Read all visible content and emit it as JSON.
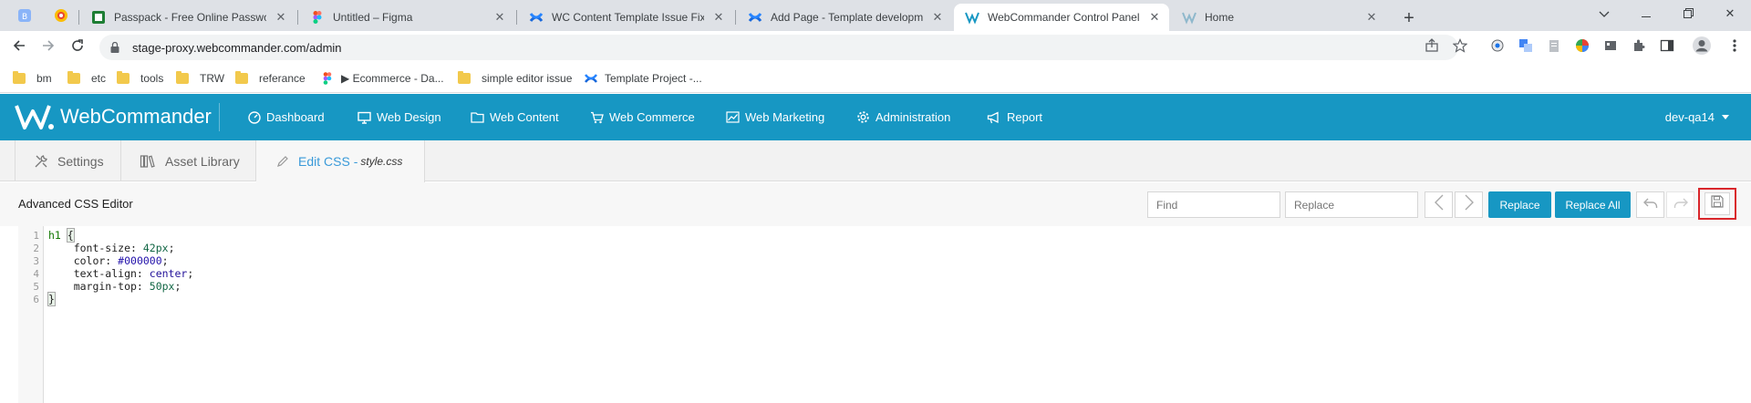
{
  "browser": {
    "tabs": [
      {
        "title": "Passpack - Free Online Password"
      },
      {
        "title": "Untitled – Figma"
      },
      {
        "title": "WC Content Template Issue Fixin"
      },
      {
        "title": "Add Page - Template developme"
      },
      {
        "title": "WebCommander Control Panel"
      },
      {
        "title": "Home"
      }
    ],
    "url": "stage-proxy.webcommander.com/admin",
    "bookmarks": [
      {
        "label": "bm"
      },
      {
        "label": "etc"
      },
      {
        "label": "tools"
      },
      {
        "label": "TRW"
      },
      {
        "label": "referance"
      },
      {
        "label": "▶ Ecommerce - Da..."
      },
      {
        "label": "simple editor issue"
      },
      {
        "label": "Template Project -..."
      }
    ]
  },
  "app": {
    "logo": "WebCommander",
    "nav": [
      {
        "label": "Dashboard",
        "icon": "dashboard-icon"
      },
      {
        "label": "Web Design",
        "icon": "monitor-icon"
      },
      {
        "label": "Web Content",
        "icon": "folder-icon"
      },
      {
        "label": "Web Commerce",
        "icon": "cart-icon"
      },
      {
        "label": "Web Marketing",
        "icon": "chart-icon"
      },
      {
        "label": "Administration",
        "icon": "gear-icon"
      },
      {
        "label": "Report",
        "icon": "megaphone-icon"
      }
    ],
    "user": "dev-qa14",
    "accent": "#1797c3"
  },
  "subtabs": {
    "settings": "Settings",
    "asset_library": "Asset Library",
    "edit_css": "Edit CSS -",
    "edit_css_file": "style.css"
  },
  "editor": {
    "title": "Advanced CSS Editor",
    "find_placeholder": "Find",
    "replace_placeholder": "Replace",
    "replace_label": "Replace",
    "replace_all_label": "Replace All",
    "line_numbers": [
      "1",
      "2",
      "3",
      "4",
      "5",
      "6"
    ],
    "code": {
      "l1_sel": "h1",
      "l1_brace": "{",
      "l2_prop": "    font-size: ",
      "l2_val": "42px",
      "l3_prop": "    color: ",
      "l3_val": "#000000",
      "l4_prop": "    text-align: ",
      "l4_val": "center",
      "l5_prop": "    margin-top: ",
      "l5_val": "50px",
      "semi": ";",
      "l6_brace": "}"
    }
  }
}
